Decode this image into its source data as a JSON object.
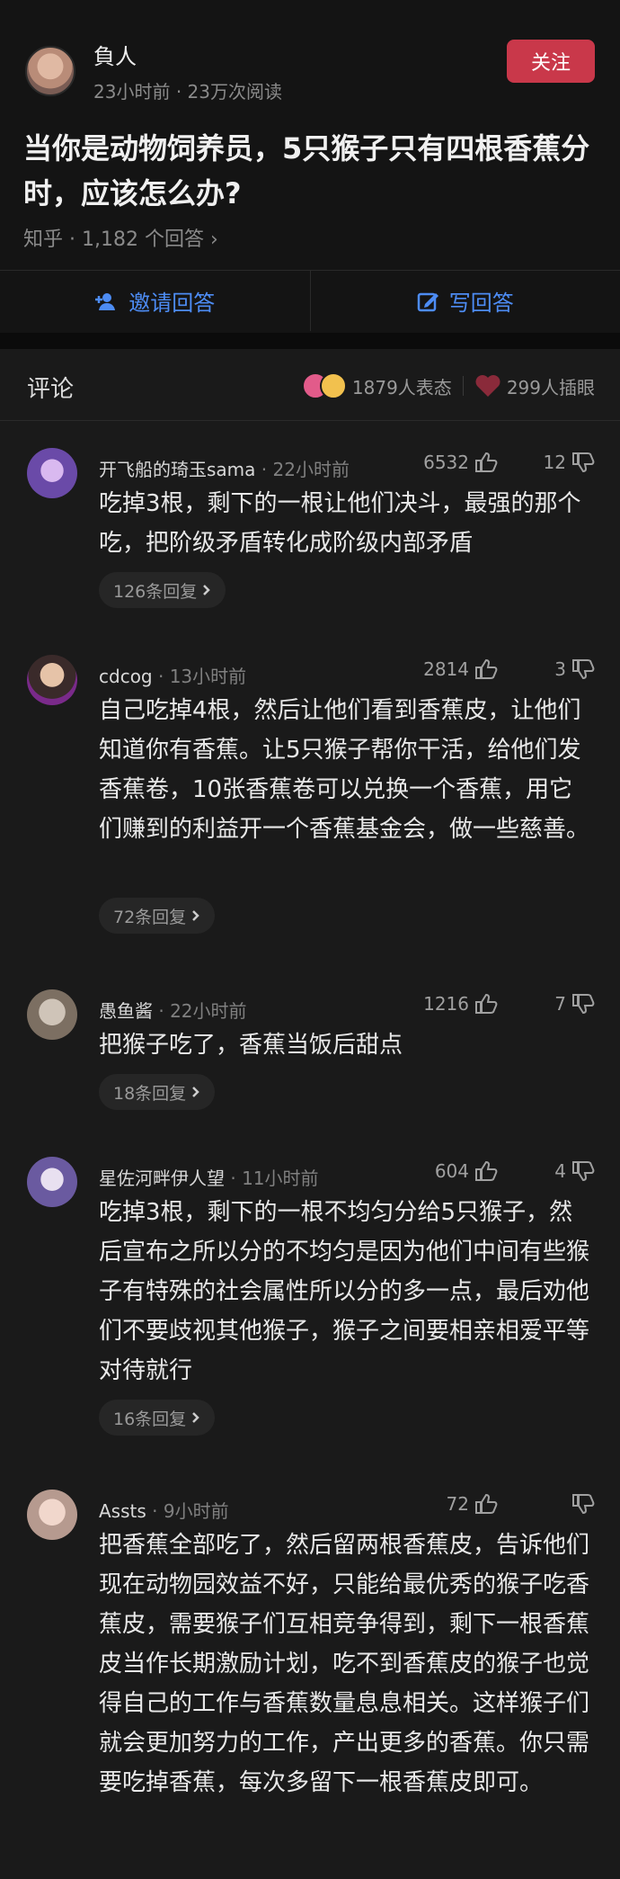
{
  "author": {
    "name": "負人",
    "time": "23小时前",
    "views": "23万次阅读",
    "follow_label": "关注"
  },
  "question": {
    "title": "当你是动物饲养员，5只猴子只有四根香蕉分时，应该怎么办?",
    "meta": "知乎 · 1,182 个回答 ›"
  },
  "actions": {
    "invite_label": "邀请回答",
    "write_label": "写回答"
  },
  "comments_header": {
    "title": "评论",
    "reactions_count": "1879人表态",
    "hearts_count": "299人插眼"
  },
  "comments": [
    {
      "name": "开飞船的琦玉sama",
      "time": " · 22小时前",
      "likes": "6532",
      "dislikes": "12",
      "text": "吃掉3根，剩下的一根让他们决斗，最强的那个吃，把阶级矛盾转化成阶级内部矛盾",
      "replies": "126条回复"
    },
    {
      "name": "cdcog",
      "time": " · 13小时前",
      "likes": "2814",
      "dislikes": "3",
      "text": "自己吃掉4根，然后让他们看到香蕉皮，让他们知道你有香蕉。让5只猴子帮你干活，给他们发香蕉卷，10张香蕉卷可以兑换一个香蕉，用它们赚到的利益开一个香蕉基金会，做一些慈善。",
      "replies": "72条回复"
    },
    {
      "name": "愚鱼酱",
      "time": " · 22小时前",
      "likes": "1216",
      "dislikes": "7",
      "text": "把猴子吃了，香蕉当饭后甜点",
      "replies": "18条回复"
    },
    {
      "name": "星佐河畔伊人望",
      "time": " · 11小时前",
      "likes": "604",
      "dislikes": "4",
      "text": "吃掉3根，剩下的一根不均匀分给5只猴子，然后宣布之所以分的不均匀是因为他们中间有些猴子有特殊的社会属性所以分的多一点，最后劝他们不要歧视其他猴子，猴子之间要相亲相爱平等对待就行",
      "replies": "16条回复"
    },
    {
      "name": "Assts",
      "time": " · 9小时前",
      "likes": "72",
      "dislikes": "",
      "text": "把香蕉全部吃了，然后留两根香蕉皮，告诉他们现在动物园效益不好，只能给最优秀的猴子吃香蕉皮，需要猴子们互相竞争得到，剩下一根香蕉皮当作长期激励计划，吃不到香蕉皮的猴子也觉得自己的工作与香蕉数量息息相关。这样猴子们就会更加努力的工作，产出更多的香蕉。你只需要吃掉香蕉，每次多留下一根香蕉皮即可。",
      "replies": ""
    }
  ],
  "colors": {
    "accent_red": "#c9384a",
    "link_blue": "#4d8cf4"
  }
}
